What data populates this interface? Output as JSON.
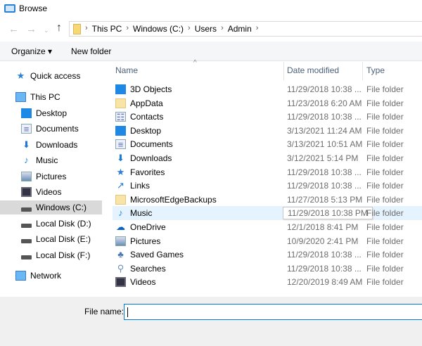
{
  "window": {
    "title": "Browse"
  },
  "address": {
    "crumbs": [
      "This PC",
      "Windows (C:)",
      "Users",
      "Admin"
    ]
  },
  "toolbar": {
    "organize": "Organize ▾",
    "new_folder": "New folder"
  },
  "nav": [
    {
      "label": "Quick access",
      "icon": "star",
      "level": 0
    },
    {
      "label": "This PC",
      "icon": "monitor",
      "level": 0
    },
    {
      "label": "Desktop",
      "icon": "desktop",
      "level": 1
    },
    {
      "label": "Documents",
      "icon": "document",
      "level": 1
    },
    {
      "label": "Downloads",
      "icon": "download",
      "level": 1
    },
    {
      "label": "Music",
      "icon": "music",
      "level": 1
    },
    {
      "label": "Pictures",
      "icon": "pictures",
      "level": 1
    },
    {
      "label": "Videos",
      "icon": "videos",
      "level": 1
    },
    {
      "label": "Windows (C:)",
      "icon": "drive",
      "level": 1,
      "selected": true
    },
    {
      "label": "Local Disk (D:)",
      "icon": "drive",
      "level": 1
    },
    {
      "label": "Local Disk (E:)",
      "icon": "drive",
      "level": 1
    },
    {
      "label": "Local Disk (F:)",
      "icon": "drive",
      "level": 1
    },
    {
      "label": "Network",
      "icon": "network",
      "level": 0
    }
  ],
  "columns": {
    "name": "Name",
    "date": "Date modified",
    "type": "Type"
  },
  "files": [
    {
      "name": "3D Objects",
      "icon": "3d",
      "date": "11/29/2018 10:38 ...",
      "type": "File folder"
    },
    {
      "name": "AppData",
      "icon": "folder",
      "date": "11/23/2018 6:20 AM",
      "type": "File folder"
    },
    {
      "name": "Contacts",
      "icon": "contacts",
      "date": "11/29/2018 10:38 ...",
      "type": "File folder"
    },
    {
      "name": "Desktop",
      "icon": "desktop",
      "date": "3/13/2021 11:24 AM",
      "type": "File folder"
    },
    {
      "name": "Documents",
      "icon": "document",
      "date": "3/13/2021 10:51 AM",
      "type": "File folder"
    },
    {
      "name": "Downloads",
      "icon": "download",
      "date": "3/12/2021 5:14 PM",
      "type": "File folder"
    },
    {
      "name": "Favorites",
      "icon": "star",
      "date": "11/29/2018 10:38 ...",
      "type": "File folder"
    },
    {
      "name": "Links",
      "icon": "link",
      "date": "11/29/2018 10:38 ...",
      "type": "File folder"
    },
    {
      "name": "MicrosoftEdgeBackups",
      "icon": "folder",
      "date": "11/27/2018 5:13 PM",
      "type": "File folder"
    },
    {
      "name": "Music",
      "icon": "music",
      "date": "11/29/2018 10:38 PM",
      "type": "File folder",
      "hover": true
    },
    {
      "name": "OneDrive",
      "icon": "cloud",
      "date": "12/1/2018 8:41 PM",
      "type": "File folder"
    },
    {
      "name": "Pictures",
      "icon": "pictures",
      "date": "10/9/2020 2:41 PM",
      "type": "File folder"
    },
    {
      "name": "Saved Games",
      "icon": "games",
      "date": "11/29/2018 10:38 ...",
      "type": "File folder"
    },
    {
      "name": "Searches",
      "icon": "search",
      "date": "11/29/2018 10:38 ...",
      "type": "File folder"
    },
    {
      "name": "Videos",
      "icon": "videos",
      "date": "12/20/2019 8:49 AM",
      "type": "File folder"
    }
  ],
  "bottom": {
    "file_name_label": "File name:",
    "file_name_value": ""
  }
}
